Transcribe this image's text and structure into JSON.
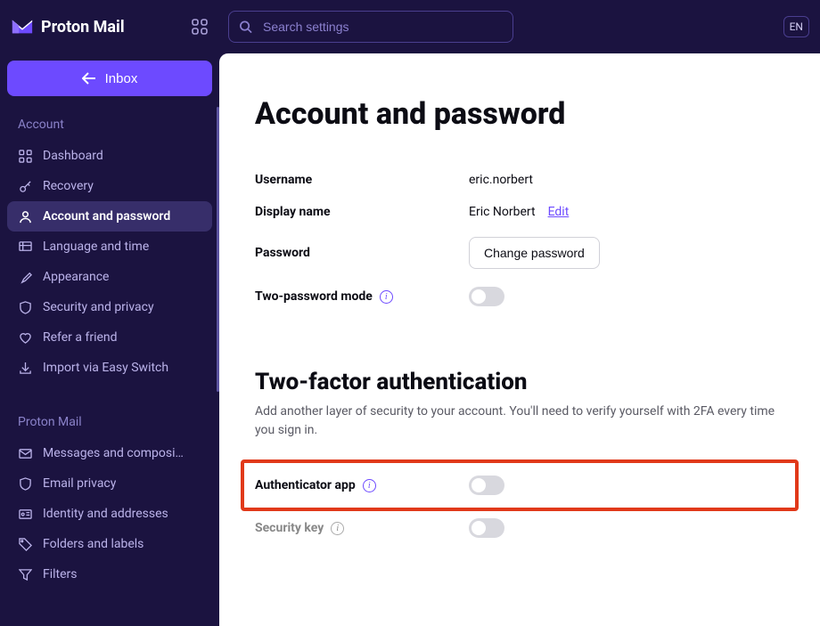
{
  "brand": "Proton Mail",
  "lang": "EN",
  "search": {
    "placeholder": "Search settings"
  },
  "inbox_button": "Inbox",
  "sidebar": {
    "sections": [
      {
        "header": "Account",
        "items": [
          {
            "label": "Dashboard",
            "icon": "grid"
          },
          {
            "label": "Recovery",
            "icon": "key"
          },
          {
            "label": "Account and password",
            "icon": "user",
            "active": true
          },
          {
            "label": "Language and time",
            "icon": "globe"
          },
          {
            "label": "Appearance",
            "icon": "brush"
          },
          {
            "label": "Security and privacy",
            "icon": "shield"
          },
          {
            "label": "Refer a friend",
            "icon": "heart"
          },
          {
            "label": "Import via Easy Switch",
            "icon": "download"
          }
        ]
      },
      {
        "header": "Proton Mail",
        "items": [
          {
            "label": "Messages and composi…",
            "icon": "message"
          },
          {
            "label": "Email privacy",
            "icon": "shield"
          },
          {
            "label": "Identity and addresses",
            "icon": "idcard"
          },
          {
            "label": "Folders and labels",
            "icon": "tag"
          },
          {
            "label": "Filters",
            "icon": "filter"
          }
        ]
      }
    ]
  },
  "page": {
    "title": "Account and password",
    "rows": {
      "username_label": "Username",
      "username_value": "eric.norbert",
      "display_label": "Display name",
      "display_value": "Eric Norbert",
      "edit": "Edit",
      "password_label": "Password",
      "password_button": "Change password",
      "two_password_label": "Two-password mode"
    },
    "tfa": {
      "title": "Two-factor authentication",
      "desc": "Add another layer of security to your account. You'll need to verify yourself with 2FA every time you sign in.",
      "auth_app": "Authenticator app",
      "security_key": "Security key"
    }
  }
}
